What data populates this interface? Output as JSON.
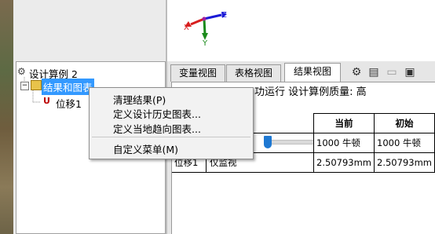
{
  "triad": {
    "z": "Z",
    "x": "X",
    "y": "Y"
  },
  "tree": {
    "root": "设计算例 2",
    "results_folder": "结果和图表",
    "sensor": "位移1"
  },
  "tabs": [
    "变量视图",
    "表格视图",
    "结果视图"
  ],
  "toolbar_icons": [
    "settings-icon",
    "report-icon",
    "open-folder-icon",
    "save-icon"
  ],
  "status": {
    "text_fragment": "功运行 设计算例质量: 高"
  },
  "context_menu": {
    "items": [
      "清理结果(P)",
      "定义设计历史图表...",
      "定义当地趋向图表...",
      "自定义菜单(M)"
    ]
  },
  "grid": {
    "col_current": "当前",
    "col_initial": "初始",
    "force_current": "1000 牛顿",
    "force_initial": "1000 牛顿",
    "sensor_name": "位移1",
    "sensor_mode": "仅监视",
    "disp_current": "2.50793mm",
    "disp_initial": "2.50793mm"
  },
  "colors": {
    "selection": "#3399ff",
    "slider_thumb": "#1e78d2"
  }
}
